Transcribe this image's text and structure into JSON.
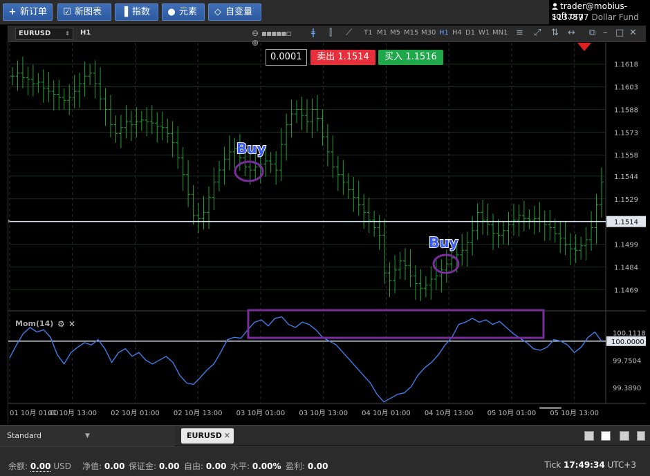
{
  "toolbar": {
    "buttons": [
      {
        "label": "新订单",
        "icon": "plus-icon"
      },
      {
        "label": "新图表",
        "icon": "chart-check-icon"
      },
      {
        "label": "指数",
        "icon": "bars-icon"
      },
      {
        "label": "元素",
        "icon": "shapes-icon"
      },
      {
        "label": "自变量",
        "icon": "diamond-icon"
      }
    ]
  },
  "account": {
    "email": "trader@mobius-soft.org",
    "number": "1137577",
    "fund": "Dollar Fund"
  },
  "chart_toolbar": {
    "symbol": "EURUSD",
    "timeframe": "H1",
    "timeframes": [
      "T1",
      "M1",
      "M5",
      "M15",
      "M30",
      "H1",
      "H4",
      "D1",
      "W1",
      "MN1"
    ],
    "active_timeframe": "H1"
  },
  "trade_panel": {
    "lot": "0.0001",
    "sell_label": "卖出",
    "sell_price": "1.1514",
    "buy_label": "买入",
    "buy_price": "1.1516",
    "sell_color": "#e8303c",
    "buy_color": "#1ea84a"
  },
  "chart_data": [
    {
      "type": "ohlc",
      "symbol": "EURUSD",
      "timeframe": "H1",
      "y_ticks": [
        "1.1618",
        "1.1603",
        "1.1588",
        "1.1573",
        "1.1558",
        "1.1544",
        "1.1529",
        "1.1514",
        "1.1499",
        "1.1484",
        "1.1469"
      ],
      "ylim": [
        1.1455,
        1.1632
      ],
      "current_price": "1.1514",
      "x_ticks": [
        "01 10月 01:00",
        "01 10月 13:00",
        "02 10月 01:00",
        "02 10月 13:00",
        "03 10月 01:00",
        "03 10月 13:00",
        "04 10月 01:00",
        "04 10月 13:00",
        "05 10月 01:00",
        "05 10月 13:00"
      ],
      "bar_color": "#1fa33a",
      "close_series": [
        1.161,
        1.1612,
        1.1609,
        1.1608,
        1.1605,
        1.1606,
        1.1602,
        1.16,
        1.1598,
        1.1596,
        1.1594,
        1.1596,
        1.16,
        1.1605,
        1.161,
        1.1612,
        1.1605,
        1.1595,
        1.1588,
        1.1578,
        1.1572,
        1.1576,
        1.158,
        1.1578,
        1.158,
        1.1581,
        1.158,
        1.1579,
        1.1577,
        1.1576,
        1.1572,
        1.1566,
        1.1556,
        1.1545,
        1.1532,
        1.1518,
        1.1516,
        1.152,
        1.153,
        1.154,
        1.1548,
        1.1555,
        1.156,
        1.1562,
        1.1556,
        1.155,
        1.1548,
        1.155,
        1.1552,
        1.1554,
        1.1552,
        1.1548,
        1.1565,
        1.1578,
        1.1585,
        1.1588,
        1.1584,
        1.158,
        1.1588,
        1.1582,
        1.157,
        1.156,
        1.155,
        1.1545,
        1.154,
        1.1535,
        1.153,
        1.1525,
        1.152,
        1.1515,
        1.151,
        1.1505,
        1.148,
        1.1475,
        1.1482,
        1.1488,
        1.1485,
        1.1478,
        1.1473,
        1.147,
        1.1472,
        1.1476,
        1.1478,
        1.1482,
        1.1486,
        1.149,
        1.1492,
        1.1495,
        1.15,
        1.1508,
        1.152,
        1.1515,
        1.1512,
        1.1506,
        1.1505,
        1.1508,
        1.1512,
        1.1515,
        1.1518,
        1.1516,
        1.1515,
        1.1516,
        1.1514,
        1.1512,
        1.151,
        1.1506,
        1.1503,
        1.1499,
        1.1496,
        1.1495,
        1.1498,
        1.1502,
        1.151,
        1.1525,
        1.154
      ]
    },
    {
      "type": "line",
      "name": "Mom(14)",
      "y_ticks": [
        "100.1118",
        "99.7504",
        "99.3890"
      ],
      "ylim": [
        99.18,
        100.38
      ],
      "current_value": "100.0000",
      "line_color": "#3f7ee8",
      "values": [
        99.78,
        99.95,
        100.1,
        100.18,
        100.12,
        100.15,
        100.05,
        99.82,
        99.7,
        99.85,
        99.92,
        99.98,
        99.95,
        100.02,
        99.9,
        99.72,
        99.85,
        99.9,
        99.8,
        99.85,
        99.75,
        99.7,
        99.75,
        99.8,
        99.72,
        99.55,
        99.45,
        99.43,
        99.52,
        99.62,
        99.7,
        99.85,
        100.02,
        100.05,
        100.04,
        100.15,
        100.25,
        100.28,
        100.2,
        100.3,
        100.32,
        100.22,
        100.18,
        100.25,
        100.22,
        100.15,
        100.05,
        100.0,
        99.95,
        99.85,
        99.75,
        99.65,
        99.55,
        99.45,
        99.3,
        99.2,
        99.25,
        99.3,
        99.32,
        99.4,
        99.55,
        99.65,
        99.72,
        99.82,
        99.95,
        100.05,
        100.22,
        100.25,
        100.3,
        100.25,
        100.28,
        100.22,
        100.26,
        100.18,
        100.1,
        100.04,
        99.98,
        99.9,
        99.88,
        99.92,
        100.02,
        100.0,
        99.95,
        99.85,
        99.92,
        100.05,
        100.12,
        100.0
      ]
    }
  ],
  "indicator": {
    "name": "Mom(14)"
  },
  "annotations": {
    "buy_label_1": "Buy",
    "buy_label_2": "Buy"
  },
  "tabs": {
    "profile": "Standard",
    "symbol_tab": "EURUSD"
  },
  "status": {
    "balance_label": "余额:",
    "balance_value": "0.00",
    "balance_currency": "USD",
    "equity_label": "净值:",
    "equity_value": "0.00",
    "margin_label": "保证金:",
    "margin_value": "0.00",
    "free_label": "自由:",
    "free_value": "0.00",
    "level_label": "水平:",
    "level_value": "0.00%",
    "profit_label": "盈利:",
    "profit_value": "0.00",
    "tick_label": "Tick",
    "time": "17:49:34",
    "timezone": "UTC+3"
  }
}
